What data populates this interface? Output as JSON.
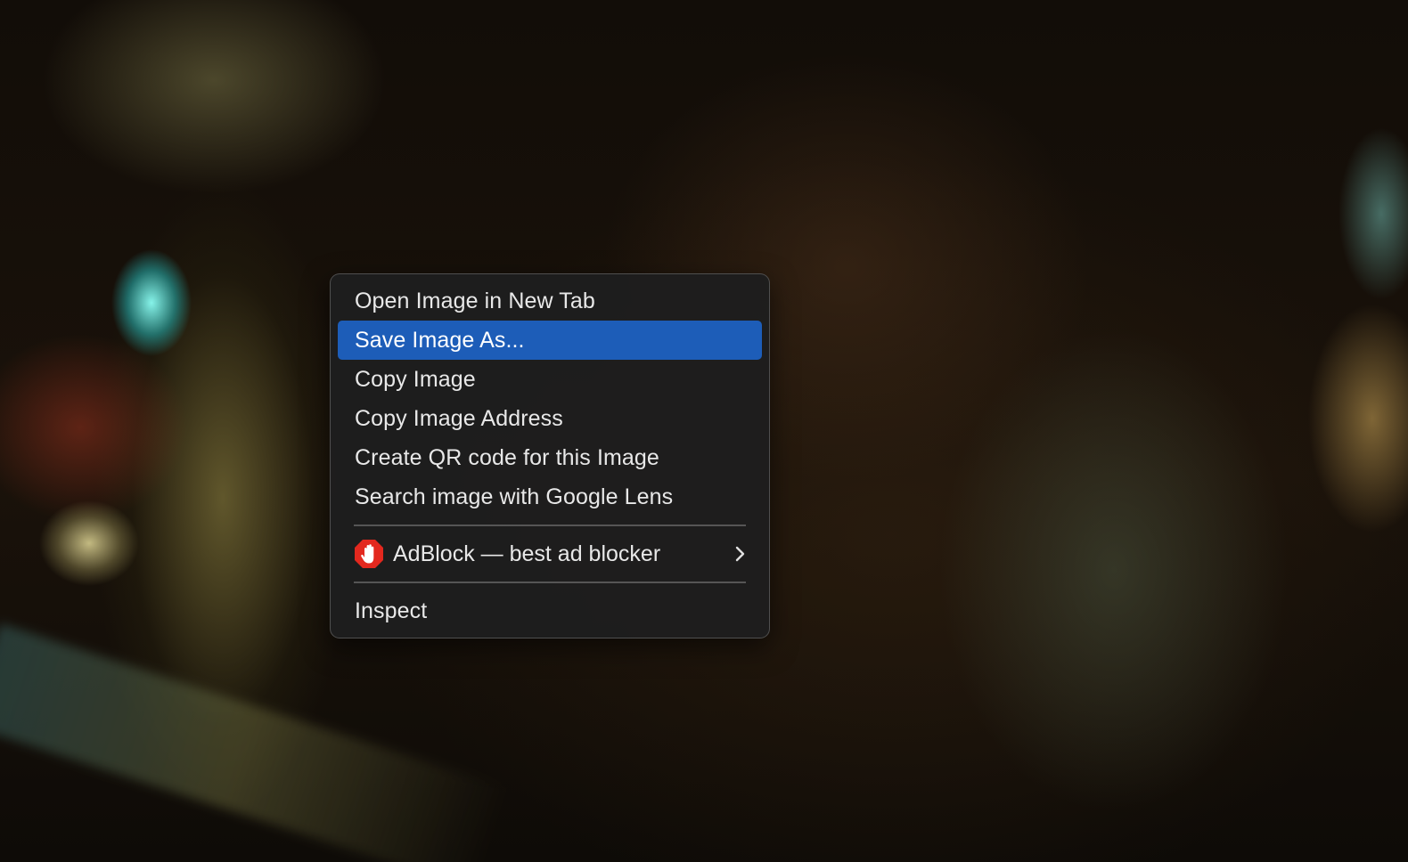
{
  "background": {
    "description_icon": "photo-background"
  },
  "context_menu": {
    "items": [
      {
        "label": "Open Image in New Tab"
      },
      {
        "label": "Save Image As...",
        "selected": true
      },
      {
        "label": "Copy Image"
      },
      {
        "label": "Copy Image Address"
      },
      {
        "label": "Create QR code for this Image"
      },
      {
        "label": "Search image with Google Lens"
      }
    ],
    "extension_item": {
      "label": "AdBlock — best ad blocker",
      "icon": "adblock-hand-icon",
      "submenu_icon": "chevron-right-icon"
    },
    "inspect_item": {
      "label": "Inspect"
    }
  },
  "colors": {
    "menu_background": "#1e1e1e",
    "selection_highlight": "#1d5db8",
    "adblock_red": "#e3281e"
  }
}
